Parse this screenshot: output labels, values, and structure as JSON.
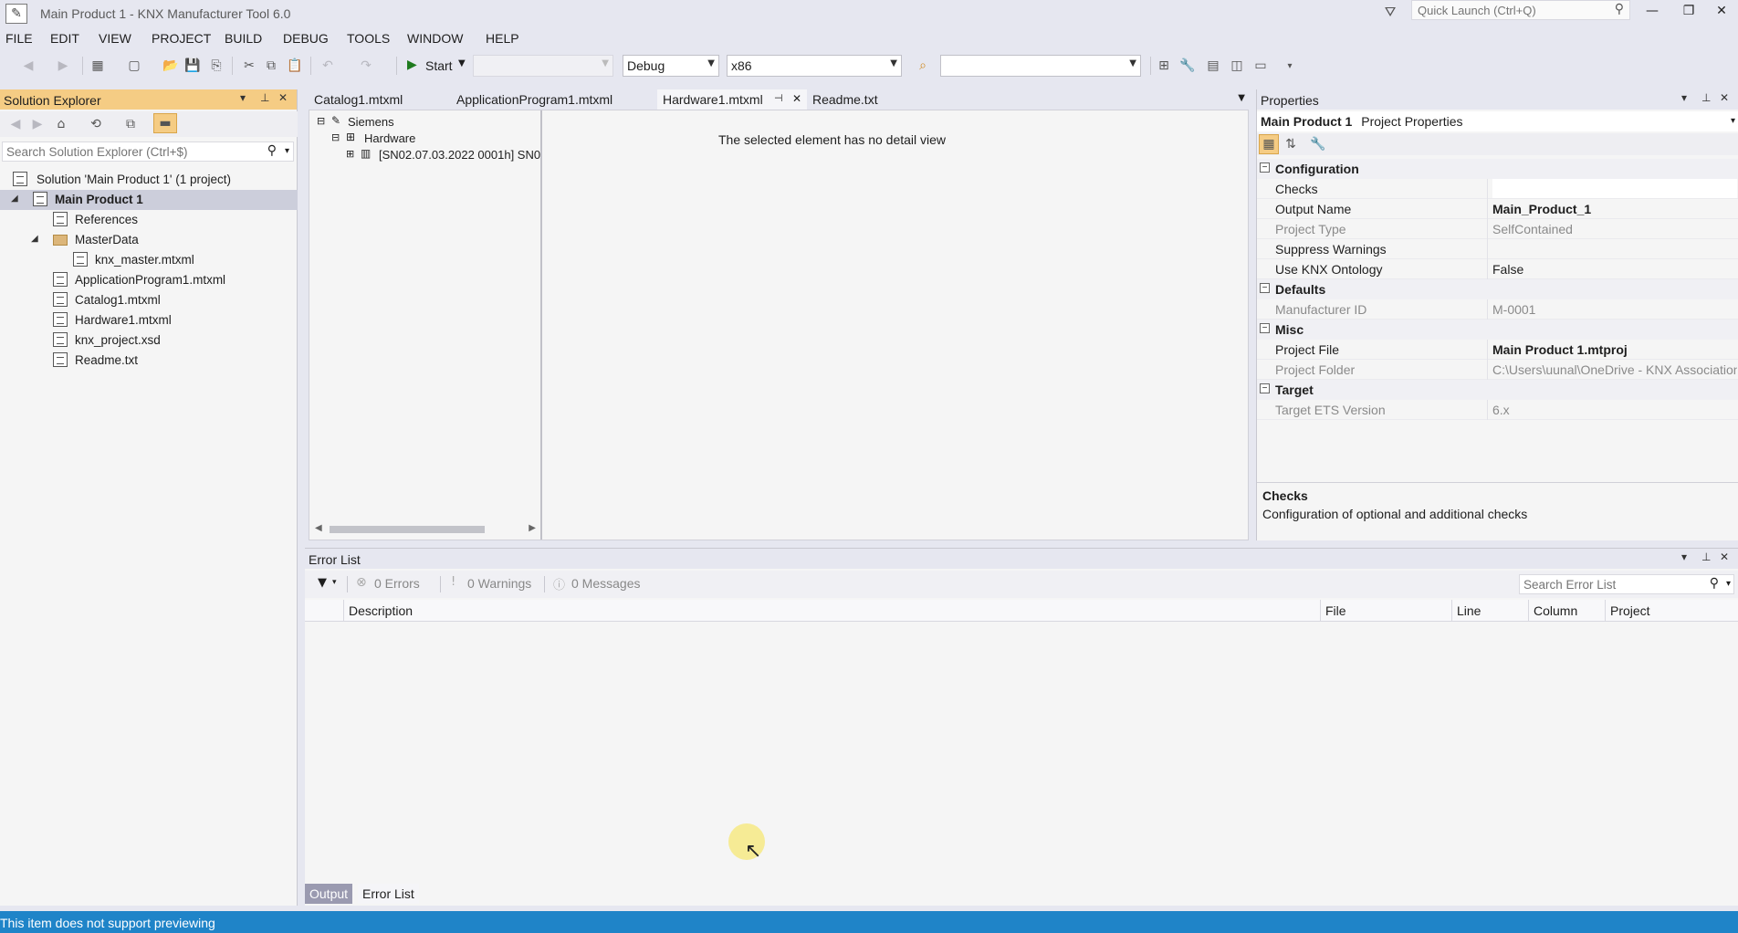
{
  "window": {
    "title": "Main Product 1 - KNX Manufacturer Tool 6.0",
    "quick_launch_placeholder": "Quick Launch (Ctrl+Q)"
  },
  "menu": [
    "FILE",
    "EDIT",
    "VIEW",
    "PROJECT",
    "BUILD",
    "DEBUG",
    "TOOLS",
    "WINDOW",
    "HELP"
  ],
  "toolbar": {
    "start_label": "Start",
    "configuration": "Debug",
    "platform": "x86"
  },
  "solution_explorer": {
    "title": "Solution Explorer",
    "search_placeholder": "Search Solution Explorer (Ctrl+$)",
    "items": [
      {
        "label": "Solution 'Main Product 1' (1 project)"
      },
      {
        "label": "Main Product 1"
      },
      {
        "label": "References"
      },
      {
        "label": "MasterData"
      },
      {
        "label": "knx_master.mtxml"
      },
      {
        "label": "ApplicationProgram1.mtxml"
      },
      {
        "label": "Catalog1.mtxml"
      },
      {
        "label": "Hardware1.mtxml"
      },
      {
        "label": "knx_project.xsd"
      },
      {
        "label": "Readme.txt"
      }
    ]
  },
  "doc_tabs": [
    {
      "label": "Catalog1.mtxml"
    },
    {
      "label": "ApplicationProgram1.mtxml"
    },
    {
      "label": "Hardware1.mtxml"
    },
    {
      "label": "Readme.txt"
    }
  ],
  "hardware_tree": {
    "items": [
      {
        "label": "Siemens"
      },
      {
        "label": "Hardware"
      },
      {
        "label": "[SN02.07.03.2022 0001h] SN0"
      }
    ],
    "detail_message": "The selected element has no detail view"
  },
  "properties": {
    "title": "Properties",
    "object_name": "Main Product 1",
    "object_type": "Project Properties",
    "categories": {
      "configuration": "Configuration",
      "defaults": "Defaults",
      "misc": "Misc",
      "target": "Target"
    },
    "rows": {
      "checks": {
        "name": "Checks",
        "value": ""
      },
      "output_name": {
        "name": "Output Name",
        "value": "Main_Product_1"
      },
      "project_type": {
        "name": "Project Type",
        "value": "SelfContained"
      },
      "suppress_warnings": {
        "name": "Suppress Warnings",
        "value": ""
      },
      "use_knx_ontology": {
        "name": "Use KNX Ontology",
        "value": "False"
      },
      "manufacturer_id": {
        "name": "Manufacturer ID",
        "value": "M-0001"
      },
      "project_file": {
        "name": "Project File",
        "value": "Main Product 1.mtproj"
      },
      "project_folder": {
        "name": "Project Folder",
        "value": "C:\\Users\\uunal\\OneDrive - KNX Association"
      },
      "target_ets_version": {
        "name": "Target ETS Version",
        "value": "6.x"
      }
    },
    "description": {
      "title": "Checks",
      "text": "Configuration of optional and additional checks"
    }
  },
  "error_list": {
    "title": "Error List",
    "errors": "0 Errors",
    "warnings": "0 Warnings",
    "messages": "0 Messages",
    "search_placeholder": "Search Error List",
    "columns": [
      "Description",
      "File",
      "Line",
      "Column",
      "Project"
    ]
  },
  "bottom_tabs": [
    "Output",
    "Error List"
  ],
  "status_bar": "This item does not support previewing",
  "colors": {
    "accent": "#1f84c8",
    "active_panel_header": "#f5cc84",
    "selected_row": "#cccedb"
  }
}
